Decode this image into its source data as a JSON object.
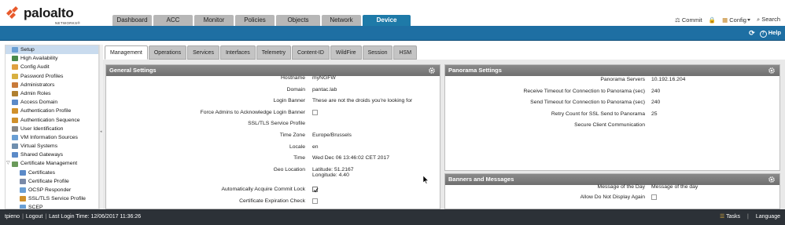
{
  "brand": {
    "name": "paloalto",
    "tagline": "NETWORKS®"
  },
  "main_tabs": [
    {
      "label": "Dashboard",
      "w": 50
    },
    {
      "label": "ACC",
      "w": 50
    },
    {
      "label": "Monitor",
      "w": 50
    },
    {
      "label": "Policies",
      "w": 50
    },
    {
      "label": "Objects",
      "w": 56
    },
    {
      "label": "Network",
      "w": 50
    },
    {
      "label": "Device",
      "w": 61,
      "active": true
    }
  ],
  "top_actions": {
    "commit": "Commit",
    "config": "Config",
    "search": "Search"
  },
  "bluebar": {
    "help": "Help"
  },
  "sidebar": {
    "items": [
      {
        "label": "Setup",
        "indent": 0,
        "icon_color": "#6a9fd4",
        "selected": true
      },
      {
        "label": "High Availability",
        "indent": 0,
        "icon_color": "#4a8a4a"
      },
      {
        "label": "Config Audit",
        "indent": 0,
        "icon_color": "#e0a040"
      },
      {
        "label": "Password Profiles",
        "indent": 0,
        "icon_color": "#d8b040"
      },
      {
        "label": "Administrators",
        "indent": 0,
        "icon_color": "#c87a3a"
      },
      {
        "label": "Admin Roles",
        "indent": 0,
        "icon_color": "#b08030"
      },
      {
        "label": "Access Domain",
        "indent": 0,
        "icon_color": "#5b8ac8"
      },
      {
        "label": "Authentication Profile",
        "indent": 0,
        "icon_color": "#d0902a"
      },
      {
        "label": "Authentication Sequence",
        "indent": 0,
        "icon_color": "#d0902a"
      },
      {
        "label": "User Identification",
        "indent": 0,
        "icon_color": "#888888"
      },
      {
        "label": "VM Information Sources",
        "indent": 0,
        "icon_color": "#6a9fd4"
      },
      {
        "label": "Virtual Systems",
        "indent": 0,
        "icon_color": "#6f8faf"
      },
      {
        "label": "Shared Gateways",
        "indent": 0,
        "icon_color": "#5b8ac8"
      },
      {
        "label": "Certificate Management",
        "indent": 0,
        "icon_color": "#6a9a5a",
        "expander": "▽"
      },
      {
        "label": "Certificates",
        "indent": 1,
        "icon_color": "#5b8ac8"
      },
      {
        "label": "Certificate Profile",
        "indent": 1,
        "icon_color": "#7a8aa8"
      },
      {
        "label": "OCSP Responder",
        "indent": 1,
        "icon_color": "#6a9fd4"
      },
      {
        "label": "SSL/TLS Service Profile",
        "indent": 1,
        "icon_color": "#d0902a"
      },
      {
        "label": "SCEP",
        "indent": 1,
        "icon_color": "#6a9fd4"
      }
    ]
  },
  "sub_tabs": [
    {
      "label": "Management",
      "active": true
    },
    {
      "label": "Operations"
    },
    {
      "label": "Services"
    },
    {
      "label": "Interfaces"
    },
    {
      "label": "Telemetry"
    },
    {
      "label": "Content-ID"
    },
    {
      "label": "WildFire"
    },
    {
      "label": "Session"
    },
    {
      "label": "HSM"
    }
  ],
  "general": {
    "title": "General Settings",
    "rows": [
      {
        "label": "Hostname",
        "value": "myNGFW"
      },
      {
        "label": "Domain",
        "value": "pantac.lab"
      },
      {
        "label": "Login Banner",
        "value": "These are not the droids you're looking for"
      },
      {
        "label": "Force Admins to Acknowledge Login Banner",
        "checkbox": false
      },
      {
        "label": "SSL/TLS Service Profile",
        "value": ""
      },
      {
        "label": "Time Zone",
        "value": "Europe/Brussels"
      },
      {
        "label": "Locale",
        "value": "en"
      },
      {
        "label": "Time",
        "value": "Wed Dec 06 13:46:02 CET 2017"
      },
      {
        "label": "Geo Location",
        "value": "Latitude: 51.2167",
        "value2": "Longitude: 4.40",
        "tall": true
      },
      {
        "label": "Automatically Acquire Commit Lock",
        "checkbox": true
      },
      {
        "label": "Certificate Expiration Check",
        "checkbox": false
      }
    ]
  },
  "panorama": {
    "title": "Panorama Settings",
    "rows": [
      {
        "label": "Panorama Servers",
        "value": "10.192.16.204"
      },
      {
        "label": "Receive Timeout for Connection to Panorama (sec)",
        "value": "240"
      },
      {
        "label": "Send Timeout for Connection to Panorama (sec)",
        "value": "240"
      },
      {
        "label": "Retry Count for SSL Send to Panorama",
        "value": "25"
      },
      {
        "label": "Secure Client Communication",
        "value": ""
      }
    ]
  },
  "banners": {
    "title": "Banners and Messages",
    "rows": [
      {
        "label": "Message of the Day",
        "value": "Message of the day"
      },
      {
        "label": "Allow Do Not Display Again",
        "checkbox": false
      }
    ]
  },
  "footer": {
    "user": "tpieno",
    "logout": "Logout",
    "last_login": "Last Login Time: 12/06/2017 11:36:26",
    "tasks": "Tasks",
    "language": "Language"
  }
}
